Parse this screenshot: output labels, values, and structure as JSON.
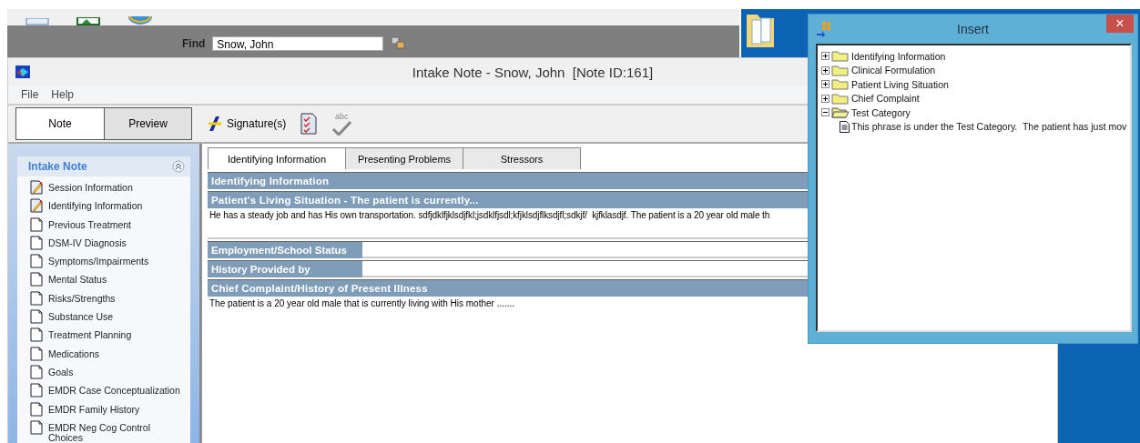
{
  "find": {
    "label": "Find",
    "value": "Snow, John"
  },
  "window": {
    "title": "Intake Note - Snow, John  [Note ID:161]"
  },
  "menu": [
    "File",
    "Help"
  ],
  "view_toggle": [
    {
      "label": "Note",
      "selected": true
    },
    {
      "label": "Preview",
      "selected": false
    }
  ],
  "toolbar": {
    "signature": "Signature(s)",
    "spellcheck": "abc"
  },
  "sidebar": {
    "title": "Intake Note",
    "items": [
      {
        "label": "Session Information",
        "kind": "edited"
      },
      {
        "label": "Identifying Information",
        "kind": "edited"
      },
      {
        "label": "Previous Treatment",
        "kind": "blank"
      },
      {
        "label": "DSM-IV Diagnosis",
        "kind": "blank"
      },
      {
        "label": "Symptoms/Impairments",
        "kind": "blank"
      },
      {
        "label": "Mental Status",
        "kind": "blank"
      },
      {
        "label": "Risks/Strengths",
        "kind": "blank"
      },
      {
        "label": "Substance Use",
        "kind": "blank"
      },
      {
        "label": "Treatment Planning",
        "kind": "blank"
      },
      {
        "label": "Medications",
        "kind": "blank"
      },
      {
        "label": "Goals",
        "kind": "blank"
      },
      {
        "label": "EMDR Case Conceptualization",
        "kind": "blank"
      },
      {
        "label": "EMDR Family History",
        "kind": "blank"
      },
      {
        "label": "EMDR Neg Cog Control Choices",
        "kind": "blank"
      }
    ]
  },
  "tabs": [
    {
      "label": "Identifying Information",
      "selected": true
    },
    {
      "label": "Presenting Problems",
      "selected": false
    },
    {
      "label": "Stressors",
      "selected": false
    }
  ],
  "sections": [
    {
      "kind": "header",
      "label": "Identifying Information"
    },
    {
      "kind": "header",
      "label": "Patient's Living Situation - The patient is currently..."
    },
    {
      "kind": "text",
      "value": "He has a steady job and has His own transportation. sdfjdklfjklsdjfkl;jsdklfjsdl;kfjklsdjflksdjfl;sdkjf/  kjfklasdjf. The patient is a 20 year old male th"
    },
    {
      "kind": "field",
      "label": "Employment/School Status"
    },
    {
      "kind": "field",
      "label": "History Provided by"
    },
    {
      "kind": "header",
      "label": "Chief Complaint/History of Present Illness"
    },
    {
      "kind": "note",
      "value": "The patient is a 20 year old male that is currently living with His mother ......."
    }
  ],
  "insert_dialog": {
    "title": "Insert",
    "close": "×",
    "tree": [
      {
        "label": "Identifying Information",
        "expanded": false
      },
      {
        "label": "Clinical Formulation",
        "expanded": false
      },
      {
        "label": "Patient Living Situation",
        "expanded": false
      },
      {
        "label": "Chief Complaint",
        "expanded": false
      },
      {
        "label": "Test Category",
        "expanded": true,
        "children": [
          {
            "label": "This phrase is under the Test Category.  The patient has just mov"
          }
        ]
      }
    ]
  }
}
